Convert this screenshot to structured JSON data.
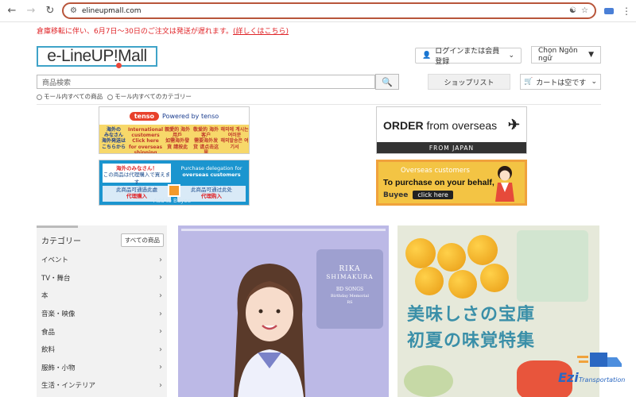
{
  "browser": {
    "url": "elineupmall.com"
  },
  "notice": {
    "text": "倉庫移転に伴い、6月7日～30日のご注文は発送が遅れます。",
    "link": "(詳しくはこちら)"
  },
  "header": {
    "logo_text": "e-LineUP!Mall",
    "login_label": "ログインまたは会員登録",
    "language_label": "Chọn Ngôn ngữ",
    "search_placeholder": "商品検索",
    "scope_all": "モール内すべての商品",
    "scope_categories": "モール内すべてのカテゴリー",
    "shopping_list_label": "ショップリスト",
    "cart_label": "カートは空です"
  },
  "banners": {
    "tenso": {
      "logo": "tenso",
      "powered": "Powered by tenso",
      "col1": "海外の\nみなさん\n海外発送は\nこちらから",
      "col2": "International customers\nClick here for overseas shipping",
      "col3": "親愛的 海外用戶\n如需海外發貨 請按此",
      "col4": "敬爱的 海外客户\n需要海外发货 请点击这里",
      "col5": "해외에 계시는 여러분\n해외발송은 여기서"
    },
    "order": {
      "line_bold": "ORDER",
      "line_rest": "from overseas",
      "footer": "FROM JAPAN"
    },
    "delegation": {
      "ja_title": "海外のみなさん！",
      "ja_sub": "この商品は代理購入で買えます",
      "en_title": "Purchase delegation for",
      "en_bold": "overseas customers",
      "zh1": "此商品可通過此處",
      "zh1_b": "代理購入",
      "zh2": "此商品可通过此处",
      "zh2_b": "代理购入",
      "add_to": "Add to Buyee"
    },
    "buyee": {
      "line1": "Overseas customers",
      "line2": "To purchase on your behalf,",
      "brand": "Buyee",
      "click": "click here"
    }
  },
  "sidebar": {
    "title": "カテゴリー",
    "all_button": "すべての商品",
    "items": [
      {
        "label": "イベント"
      },
      {
        "label": "TV・舞台"
      },
      {
        "label": "本"
      },
      {
        "label": "音楽・映像"
      },
      {
        "label": "食品"
      },
      {
        "label": "飲料"
      },
      {
        "label": "服飾・小物"
      },
      {
        "label": "生活・インテリア"
      }
    ]
  },
  "promo_idol": {
    "name1": "RIKA",
    "name2": "SHIMAKURA",
    "code": "BD SONGS",
    "sub": "Birthday Memorial",
    "tag": "RS"
  },
  "promo_food": {
    "line1": "美味しさの宝庫",
    "line2": "初夏の味覚特集"
  },
  "watermark": {
    "brand": "Ezi",
    "sub": "Transportation"
  },
  "colors": {
    "notice_red": "#e0262a",
    "logo_border": "#3fa3c8",
    "omnibox_border": "#b8553a",
    "food_title": "#3a8fa8"
  }
}
